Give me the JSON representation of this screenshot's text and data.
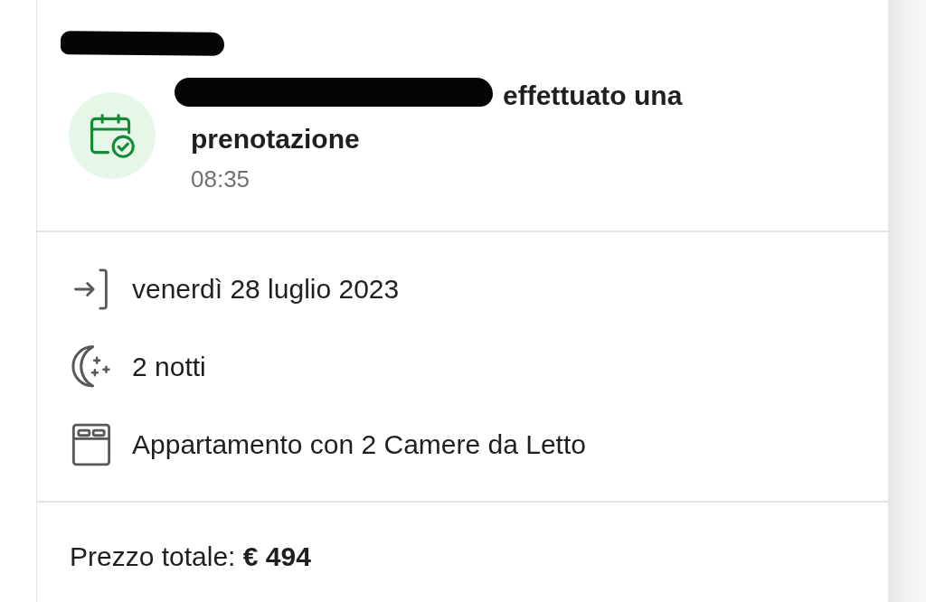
{
  "notification": {
    "headline_lines": [
      "effettuato una",
      "prenotazione"
    ],
    "time": "08:35"
  },
  "details": [
    {
      "kind": "checkin",
      "text": "venerdì 28 luglio 2023"
    },
    {
      "kind": "nights",
      "text": "2 notti"
    },
    {
      "kind": "room",
      "text": "Appartamento con 2 Camere da Letto"
    }
  ],
  "price": "Prezzo totale: **€ 494**"
}
